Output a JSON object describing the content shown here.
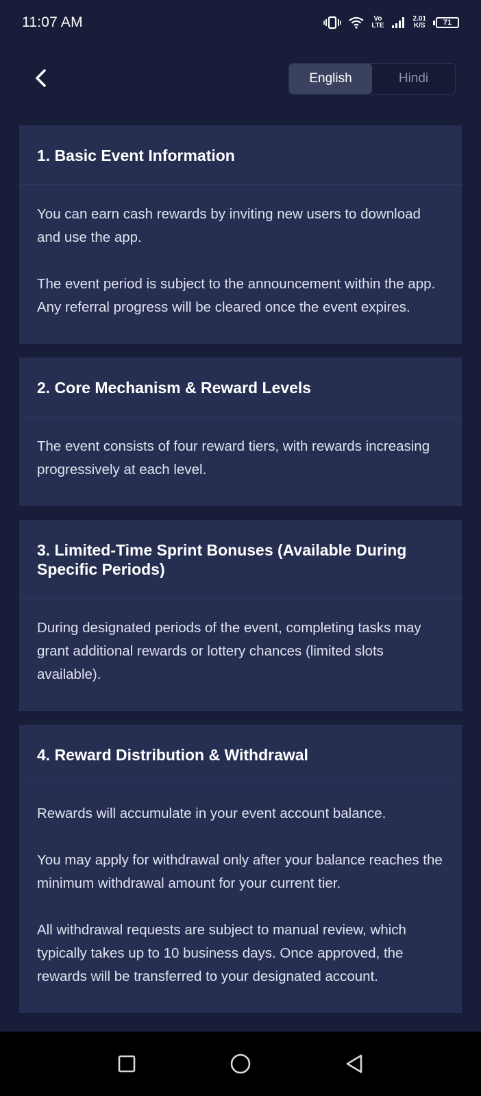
{
  "status_bar": {
    "time": "11:07 AM",
    "volte_top": "Vo",
    "volte_bottom": "LTE",
    "speed_value": "2.01",
    "speed_unit": "K/S",
    "battery": "71"
  },
  "header": {
    "languages": [
      {
        "label": "English",
        "active": true
      },
      {
        "label": "Hindi",
        "active": false
      }
    ]
  },
  "sections": [
    {
      "title": "1. Basic Event Information",
      "paragraphs": [
        "You can earn cash rewards by inviting new users to download and use the app.",
        "The event period is subject to the announcement within the app. Any referral progress will be cleared once the event expires."
      ]
    },
    {
      "title": "2. Core Mechanism & Reward Levels",
      "paragraphs": [
        "The event consists of four reward tiers, with rewards increasing progressively at each level."
      ]
    },
    {
      "title": "3. Limited-Time Sprint Bonuses (Available During Specific Periods)",
      "paragraphs": [
        "During designated periods of the event, completing tasks may grant additional rewards or lottery chances (limited slots available)."
      ]
    },
    {
      "title": "4. Reward Distribution & Withdrawal",
      "paragraphs": [
        "Rewards will accumulate in your event account balance.",
        "You may apply for withdrawal only after your balance reaches the minimum withdrawal amount for your current tier.",
        "All withdrawal requests are subject to manual review, which typically takes up to 10 business days. Once approved, the rewards will be transferred to your designated account."
      ]
    }
  ],
  "nav": {
    "icons": [
      "recent-apps-icon",
      "home-icon",
      "back-nav-icon"
    ]
  },
  "colors": {
    "background": "#181d39",
    "card": "#262e52",
    "toggle_active": "#3b4260"
  }
}
